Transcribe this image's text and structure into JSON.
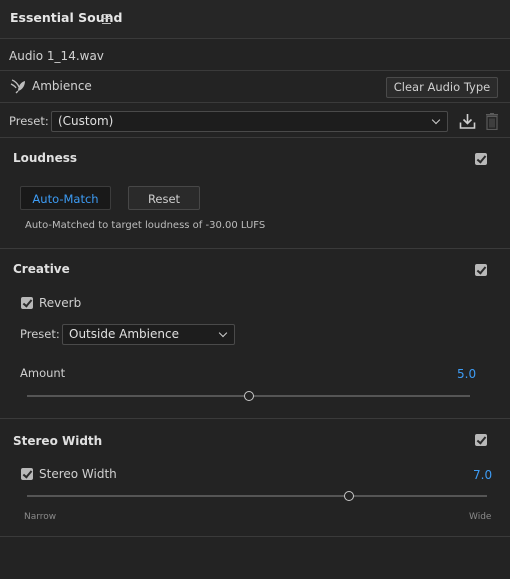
{
  "panel": {
    "title": "Essential Sound"
  },
  "clip": {
    "name": "Audio 1_14.wav"
  },
  "audio_type": {
    "label": "Ambience",
    "clear_button": "Clear Audio Type"
  },
  "preset": {
    "label": "Preset:",
    "value": "(Custom)"
  },
  "loudness": {
    "title": "Loudness",
    "enabled": true,
    "auto_match_button": "Auto-Match",
    "reset_button": "Reset",
    "note": "Auto-Matched to target loudness of -30.00 LUFS"
  },
  "creative": {
    "title": "Creative",
    "enabled": true,
    "reverb_label": "Reverb",
    "reverb_enabled": true,
    "preset_label": "Preset:",
    "preset_value": "Outside Ambience",
    "amount_label": "Amount",
    "amount_value": "5.0",
    "amount_fraction": 0.5
  },
  "stereo": {
    "title": "Stereo Width",
    "enabled": true,
    "option_label": "Stereo Width",
    "option_enabled": true,
    "value": "7.0",
    "value_fraction": 0.7,
    "min_label": "Narrow",
    "max_label": "Wide"
  },
  "colors": {
    "accent": "#3d9cf5",
    "background": "#232323"
  }
}
